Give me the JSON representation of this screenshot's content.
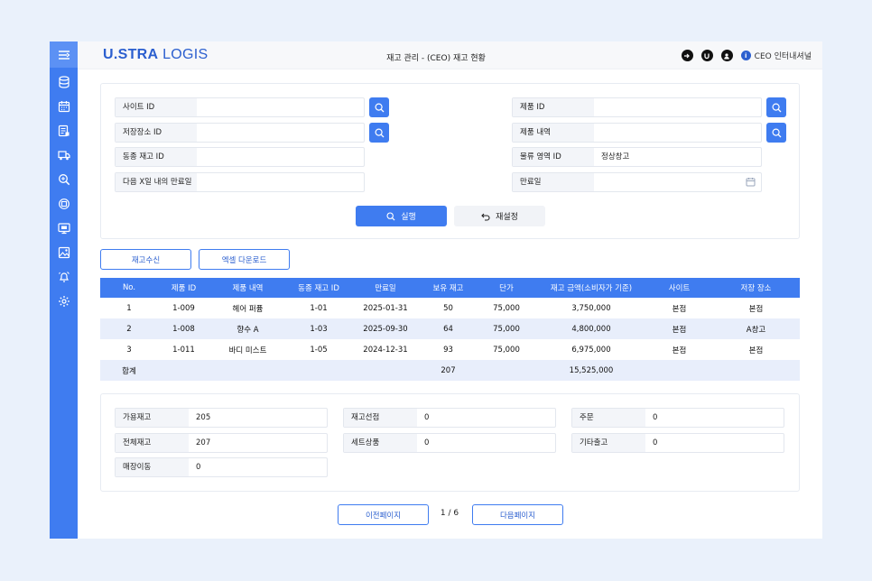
{
  "app": {
    "logo_bold": "U.STRA",
    "logo_light": " LOGIS"
  },
  "header": {
    "title": "재고 관리 - (CEO) 재고 현황",
    "user_label": "CEO 인터내셔널",
    "icons": [
      "logout-icon",
      "u-icon",
      "profile-icon",
      "info-icon"
    ]
  },
  "sidebar": {
    "items": [
      "menu-toggle-icon",
      "database-icon",
      "calendar-icon",
      "report-icon",
      "truck-icon",
      "search-inventory-icon",
      "refresh-box-icon",
      "monitor-icon",
      "image-icon",
      "bell-tool-icon",
      "settings-icon"
    ]
  },
  "filters": {
    "site_id": {
      "label": "사이트 ID",
      "value": ""
    },
    "storage_id": {
      "label": "저장장소 ID",
      "value": ""
    },
    "same_stock_id": {
      "label": "동종 재고 ID",
      "value": ""
    },
    "expiry_within": {
      "label": "다음 X일 내의 만료일",
      "value": ""
    },
    "product_id": {
      "label": "제품 ID",
      "value": ""
    },
    "product_desc": {
      "label": "제품 내역",
      "value": ""
    },
    "logistics_area": {
      "label": "물류 영역 ID",
      "value": "정상창고"
    },
    "expiry_date": {
      "label": "만료일",
      "value": ""
    },
    "run_label": "실행",
    "reset_label": "재설정"
  },
  "actions": {
    "receive_label": "재고수신",
    "excel_label": "엑셀 다운로드"
  },
  "table": {
    "columns": [
      "No.",
      "제품 ID",
      "제품 내역",
      "동종 재고 ID",
      "만료일",
      "보유 재고",
      "단가",
      "재고 금액(소비자가 기준)",
      "사이트",
      "저장 장소"
    ],
    "rows": [
      [
        "1",
        "1-009",
        "헤어 퍼퓸",
        "1-01",
        "2025-01-31",
        "50",
        "75,000",
        "3,750,000",
        "본점",
        "본점"
      ],
      [
        "2",
        "1-008",
        "향수 A",
        "1-03",
        "2025-09-30",
        "64",
        "75,000",
        "4,800,000",
        "본점",
        "A창고"
      ],
      [
        "3",
        "1-011",
        "바디 미스트",
        "1-05",
        "2024-12-31",
        "93",
        "75,000",
        "6,975,000",
        "본점",
        "본점"
      ]
    ],
    "total": {
      "label": "합계",
      "stock": "207",
      "amount": "15,525,000"
    }
  },
  "summary": {
    "available": {
      "label": "가용재고",
      "value": "205"
    },
    "total": {
      "label": "전체재고",
      "value": "207"
    },
    "store_move": {
      "label": "매장이동",
      "value": "0"
    },
    "preselect": {
      "label": "재고선점",
      "value": "0"
    },
    "set_goods": {
      "label": "세트상품",
      "value": "0"
    },
    "order": {
      "label": "주문",
      "value": "0"
    },
    "other_out": {
      "label": "기타출고",
      "value": "0"
    }
  },
  "pager": {
    "prev_label": "이전페이지",
    "next_label": "다음페이지",
    "page_text": "1 / 6"
  },
  "colors": {
    "accent": "#3f7cf0",
    "brand": "#2b5fcf",
    "row_alt": "#e8eefb"
  }
}
